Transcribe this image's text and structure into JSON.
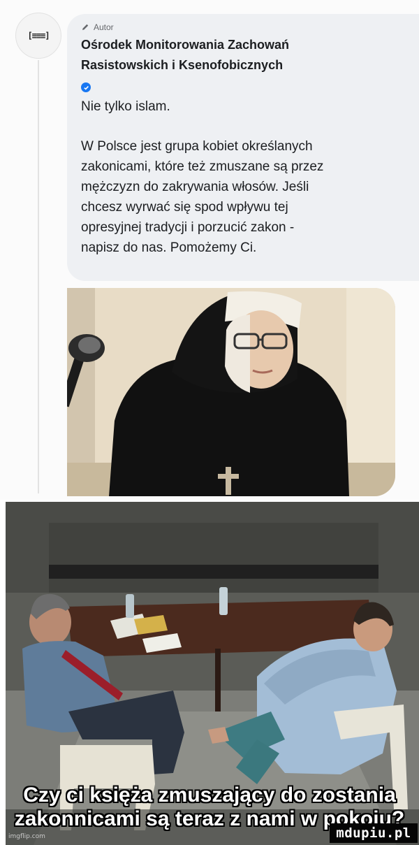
{
  "post": {
    "author_label": "Autor",
    "page_name_line1": "Ośrodek Monitorowania Zachowań",
    "page_name_line2": "Rasistowskich i Ksenofobicznych",
    "lines": [
      "Nie tylko islam.",
      "W Polsce jest grupa kobiet określanych",
      "zakonicami, które też zmuszane są przez",
      "mężczyzn do zakrywania włosów. Jeśli",
      "chcesz wyrwać się spod wpływu tej",
      "opresyjnej tradycji i porzucić zakon -",
      "napisz do nas. Pomożemy Ci."
    ],
    "avatar_icon": "logo-icon"
  },
  "meme": {
    "caption_line1": "Czy ci księża zmuszający do zostania",
    "caption_line2": "zakonnicami są teraz z nami w pokoju?",
    "imgflip_label": "imgflip.com"
  },
  "watermark": "mdupiu.pl",
  "colors": {
    "verified_blue": "#1877f2",
    "bubble_bg": "#eef0f3",
    "text_dark": "#1c1e21",
    "meme_text": "#ffffff",
    "watermark_bg": "#050505"
  }
}
